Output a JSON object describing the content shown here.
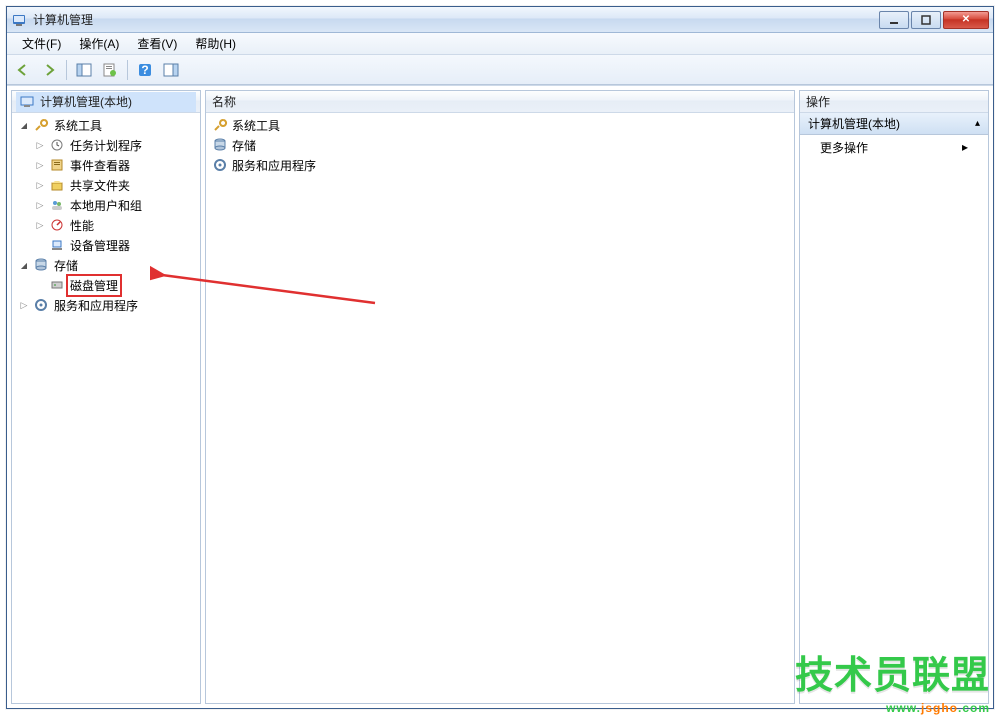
{
  "window": {
    "title": "计算机管理"
  },
  "menubar": {
    "file": "文件(F)",
    "action": "操作(A)",
    "view": "查看(V)",
    "help": "帮助(H)"
  },
  "tree": {
    "root": "计算机管理(本地)",
    "sys": "系统工具",
    "sched": "任务计划程序",
    "event": "事件查看器",
    "share": "共享文件夹",
    "users": "本地用户和组",
    "perf": "性能",
    "devmgr": "设备管理器",
    "storage": "存储",
    "disk": "磁盘管理",
    "svc": "服务和应用程序"
  },
  "listheader": "名称",
  "list": {
    "sys": "系统工具",
    "storage": "存储",
    "svc": "服务和应用程序"
  },
  "actions": {
    "header": "操作",
    "group": "计算机管理(本地)",
    "more": "更多操作"
  },
  "watermark": {
    "text": "技术员联盟",
    "p1": "www.",
    "p2": "jsgho",
    "p3": ".com"
  }
}
